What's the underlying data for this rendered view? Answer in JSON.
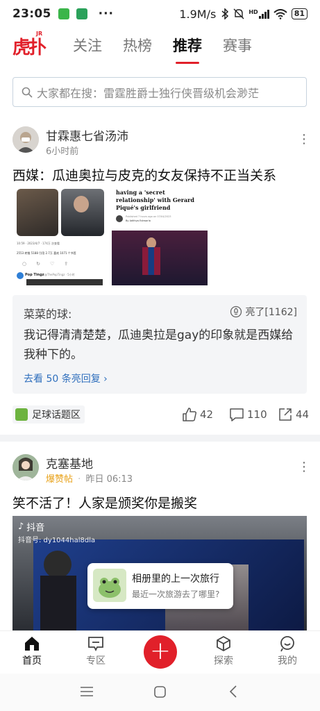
{
  "status_bar": {
    "time": "23:05",
    "speed": "1.9M/s",
    "network": "HD",
    "battery": "81"
  },
  "header": {
    "logo_text": "虎扑",
    "logo_sup": "JR",
    "tabs": [
      "关注",
      "热榜",
      "推荐",
      "赛事"
    ],
    "active_tab": "推荐"
  },
  "search": {
    "placeholder": "大家都在搜：雷霆胜爵士独行侠晋级机会渺茫"
  },
  "post1": {
    "author": "甘霖惠七省汤沛",
    "time": "6小时前",
    "title": "西媒：瓜迪奥拉与皮克的女友保持不正当关系",
    "image_text": {
      "headline": "having a 'secret relationship' with Gerard Piqué's girlfriend",
      "byline_pub": "Published 7 hours ago on 07/04/2023",
      "byline_by": "By Adithya Eshwarla",
      "tweet_time": "10:59 · 2023/4/7 · 174万 次查看",
      "tweet_stats": "2553 转推  5188 引用  2.7万 喜欢  1071 个书签",
      "tweet_handle": "Pop Tingz",
      "tweet_at": "@ThePopTingz · 5小时"
    },
    "comment": {
      "author": "菜菜的球:",
      "light_label": "亮了[1162]",
      "text": "我记得清清楚楚，瓜迪奥拉是gay的印象就是西媒给我种下的。",
      "more_link": "去看 50 条亮回复"
    },
    "zone": "足球话题区",
    "likes": "42",
    "comments": "110",
    "shares": "44"
  },
  "post2": {
    "author": "克塞基地",
    "badge": "爆赞帖",
    "time": "昨日 06:13",
    "title": "笑不活了！人家是颁奖你是搬奖",
    "video_brand": "抖音",
    "video_id": "抖音号: dy1044hal8dla",
    "popup": {
      "title": "相册里的上一次旅行",
      "subtitle": "最近一次旅游去了哪里?"
    }
  },
  "bottom_nav": {
    "items": [
      "首页",
      "专区",
      "探索",
      "我的"
    ],
    "active": "首页"
  },
  "colors": {
    "brand_red": "#e1202a",
    "link_blue": "#2f6fbd",
    "badge_gold": "#e8a21a"
  }
}
